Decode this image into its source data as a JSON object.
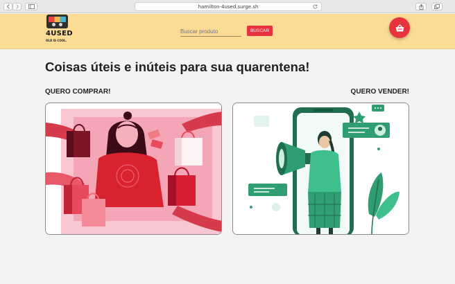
{
  "browser": {
    "url": "hamilton-4used.surge.sh"
  },
  "header": {
    "logo": {
      "name": "4USED",
      "tagline": "OLD IS COOL."
    },
    "search": {
      "placeholder": "Buscar produto",
      "value": "",
      "button_label": "BUSCAR"
    },
    "cart_icon": "basket-icon"
  },
  "main": {
    "title": "Coisas úteis e inúteis para sua quarentena!",
    "buy": {
      "label": "QUERO COMPRAR!",
      "illustration": "shopping-bags-illustration"
    },
    "sell": {
      "label": "QUERO VENDER!",
      "illustration": "phone-megaphone-illustration"
    }
  },
  "colors": {
    "header_bg": "#fcdb95",
    "accent": "#e8323f",
    "buy_pink": "#f7b6c3",
    "sell_green": "#2f9e73"
  }
}
